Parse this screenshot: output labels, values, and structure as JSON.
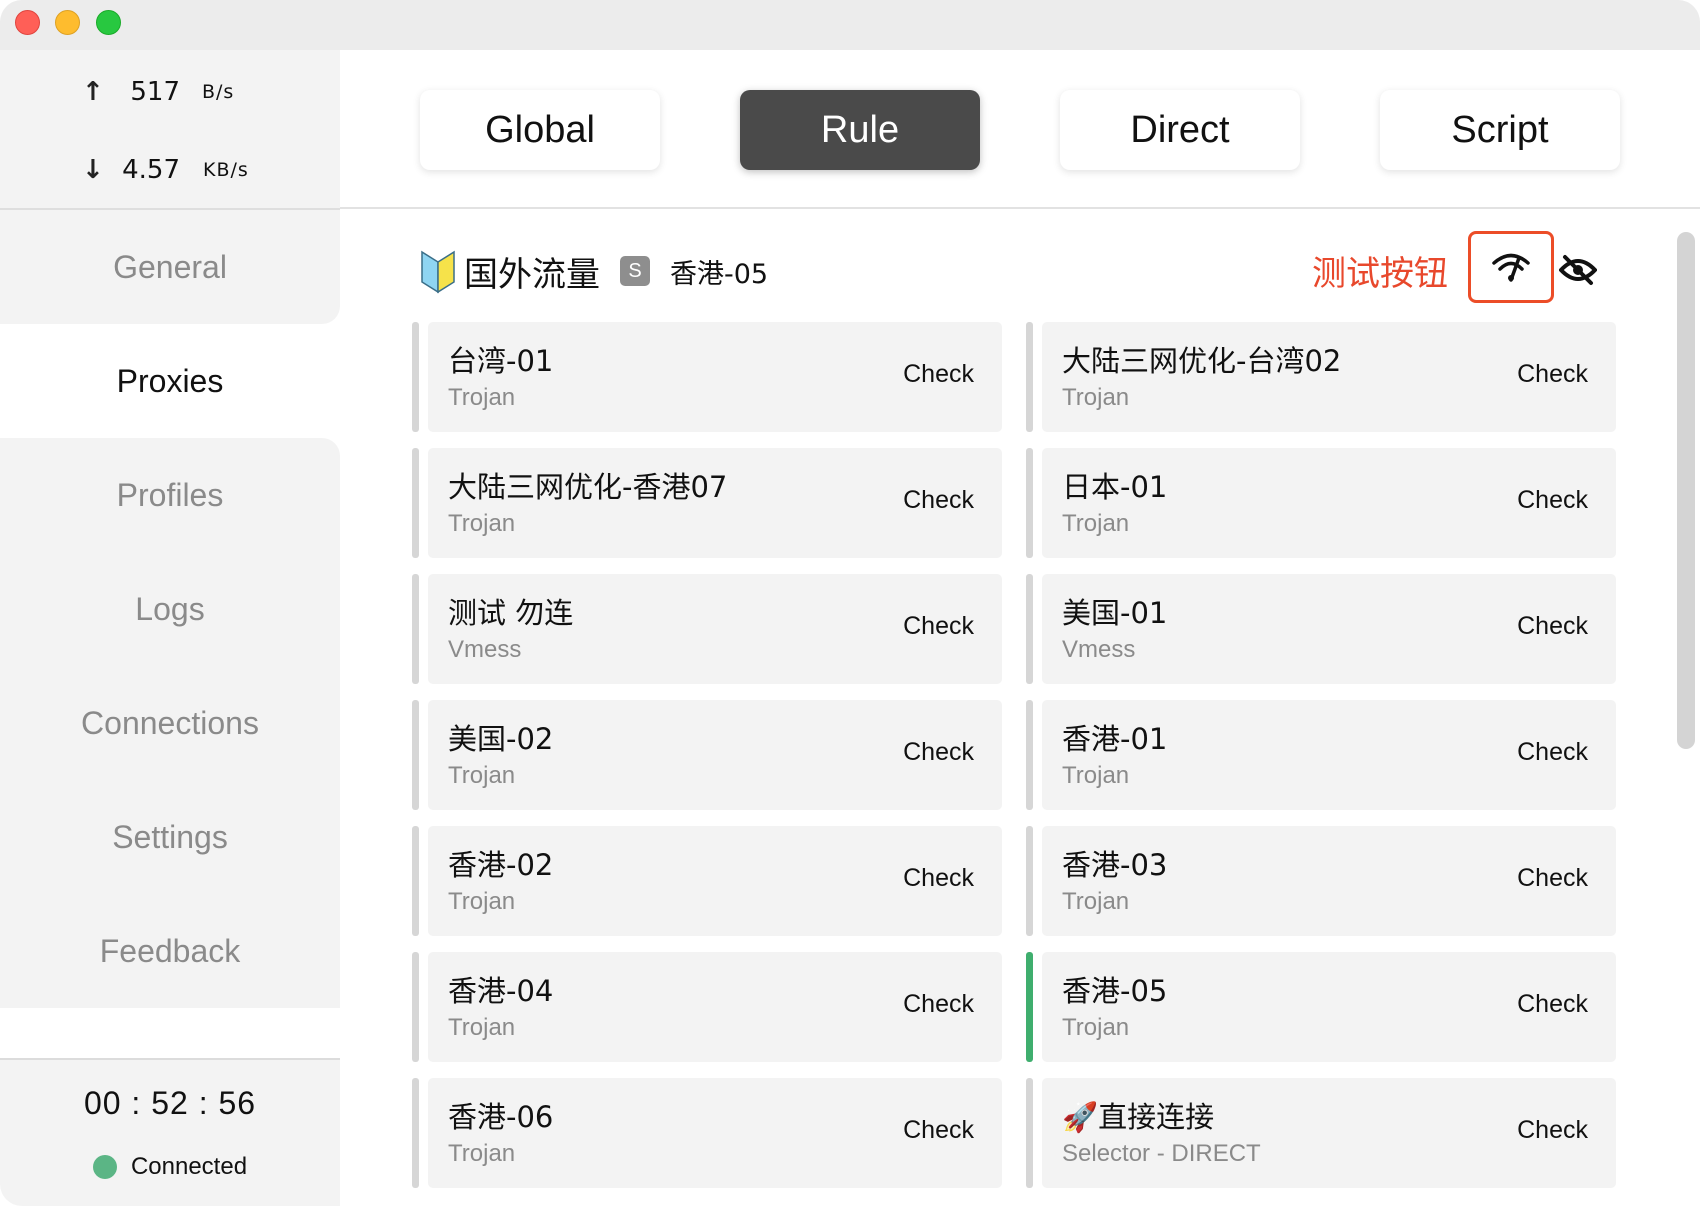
{
  "traffic": {
    "up_arrow": "↑",
    "up_value": "517",
    "up_unit": "B/s",
    "down_arrow": "↓",
    "down_value": "4.57",
    "down_unit": "KB/s"
  },
  "sidebar": {
    "items": [
      {
        "label": "General"
      },
      {
        "label": "Proxies"
      },
      {
        "label": "Profiles"
      },
      {
        "label": "Logs"
      },
      {
        "label": "Connections"
      },
      {
        "label": "Settings"
      },
      {
        "label": "Feedback"
      }
    ],
    "active": "Proxies"
  },
  "footer": {
    "timer": "00 : 52 : 56",
    "status": "Connected",
    "status_color": "#5bb585"
  },
  "modes": {
    "items": [
      {
        "label": "Global"
      },
      {
        "label": "Rule"
      },
      {
        "label": "Direct"
      },
      {
        "label": "Script"
      }
    ],
    "active": "Rule"
  },
  "group": {
    "name": "国外流量",
    "badge": "S",
    "selected": "香港-05",
    "test_label": "测试按钮",
    "test_icon": "wifi-speed-icon",
    "hide_icon": "eye-off-icon"
  },
  "proxies": [
    {
      "name": "台湾-01",
      "type": "Trojan",
      "check": "Check"
    },
    {
      "name": "大陆三网优化-台湾02",
      "type": "Trojan",
      "check": "Check"
    },
    {
      "name": "大陆三网优化-香港07",
      "type": "Trojan",
      "check": "Check"
    },
    {
      "name": "日本-01",
      "type": "Trojan",
      "check": "Check"
    },
    {
      "name": "测试 勿连",
      "type": "Vmess",
      "check": "Check"
    },
    {
      "name": "美国-01",
      "type": "Vmess",
      "check": "Check"
    },
    {
      "name": "美国-02",
      "type": "Trojan",
      "check": "Check"
    },
    {
      "name": "香港-01",
      "type": "Trojan",
      "check": "Check"
    },
    {
      "name": "香港-02",
      "type": "Trojan",
      "check": "Check"
    },
    {
      "name": "香港-03",
      "type": "Trojan",
      "check": "Check"
    },
    {
      "name": "香港-04",
      "type": "Trojan",
      "check": "Check"
    },
    {
      "name": "香港-05",
      "type": "Trojan",
      "check": "Check",
      "selected": true
    },
    {
      "name": "香港-06",
      "type": "Trojan",
      "check": "Check"
    },
    {
      "name": "🚀直接连接",
      "type": "Selector - DIRECT",
      "check": "Check"
    }
  ],
  "colors": {
    "accent_selected": "#3fae6e",
    "test_highlight": "#ec4d28",
    "active_mode_bg": "#4a4a4a"
  }
}
